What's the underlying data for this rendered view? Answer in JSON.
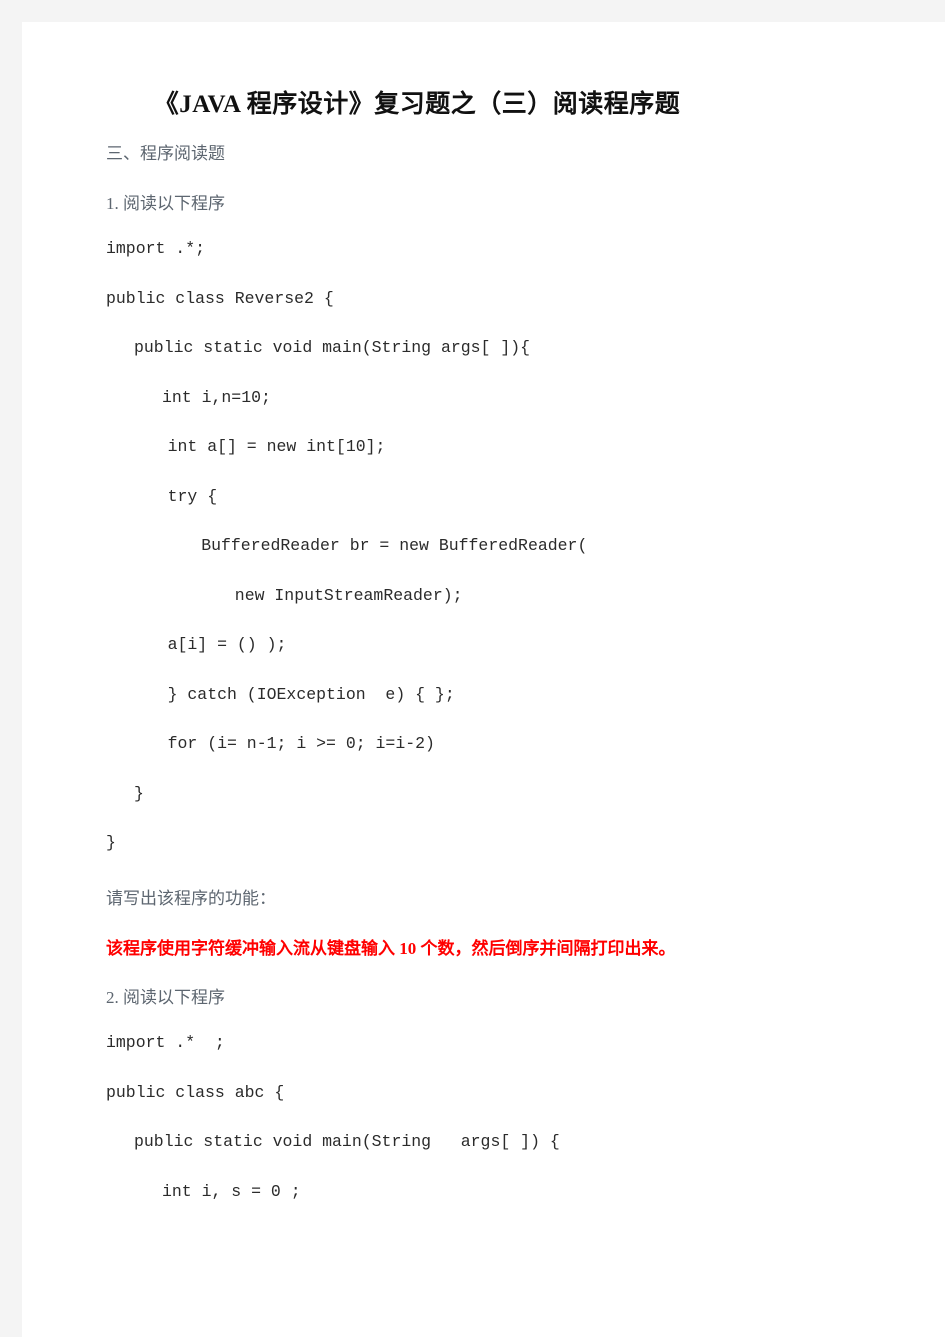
{
  "document": {
    "title": "《JAVA 程序设计》复习题之（三）阅读程序题",
    "section_heading": "三、程序阅读题",
    "question1_prompt": "1. 阅读以下程序",
    "question1_code": [
      {
        "text": "import .*;",
        "indent": 0
      },
      {
        "text": "public class Reverse2 {",
        "indent": 0
      },
      {
        "text": "public static void main(String args[ ]){",
        "indent": 1
      },
      {
        "text": "int i,n=10;",
        "indent": 2
      },
      {
        "text": "int a[] = new int[10];",
        "indent": 2.2
      },
      {
        "text": "try {",
        "indent": 2.2
      },
      {
        "text": "BufferedReader br = new BufferedReader(",
        "indent": 3.4
      },
      {
        "text": "new InputStreamReader);",
        "indent": 4.6
      },
      {
        "text": "a[i] = () );",
        "indent": 2.2
      },
      {
        "text": "} catch (IOException  e) { };",
        "indent": 2.2
      },
      {
        "text": "for (i= n-1; i >= 0; i=i-2)",
        "indent": 2.2
      },
      {
        "text": "}",
        "indent": 1
      },
      {
        "text": "}",
        "indent": 0
      }
    ],
    "question1_ask": "请写出该程序的功能：",
    "question1_answer": "该程序使用字符缓冲输入流从键盘输入 10 个数，然后倒序并间隔打印出来。",
    "question2_prompt": "2. 阅读以下程序",
    "question2_code": [
      {
        "text": "import .*  ;",
        "indent": 0
      },
      {
        "text": "public class abc {",
        "indent": 0
      },
      {
        "text": "public static void main(String   args[ ]) {",
        "indent": 1
      },
      {
        "text": "int i, s = 0 ;",
        "indent": 2
      }
    ]
  },
  "colors": {
    "page_background": "#ffffff",
    "canvas_background": "#f4f4f4",
    "title_text": "#111111",
    "body_text": "#5d6670",
    "code_text": "#2b2b2b",
    "answer_text": "#ff0000"
  }
}
